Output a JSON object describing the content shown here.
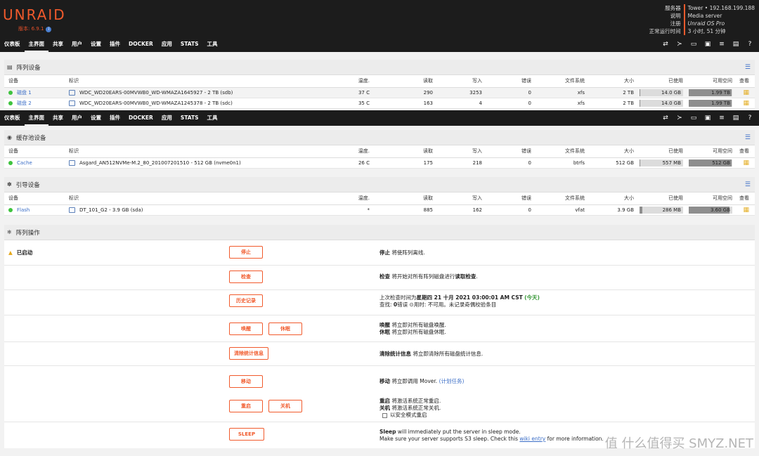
{
  "app": {
    "logo": "UNRAID",
    "version": "版本: 6.9.1"
  },
  "server": {
    "keys": [
      "服务器",
      "说明",
      "注册",
      "正常运行时间"
    ],
    "values": [
      "Tower • 192.168.199.188",
      "Media server",
      "Unraid OS Pro",
      "3 小时, 51 分钟"
    ]
  },
  "nav": {
    "items": [
      "仪表板",
      "主界面",
      "共享",
      "用户",
      "设置",
      "插件",
      "DOCKER",
      "应用",
      "STATS",
      "工具"
    ]
  },
  "array": {
    "title": "阵列设备",
    "headers": [
      "设备",
      "标识",
      "温度.",
      "读取",
      "写入",
      "错误",
      "文件系统",
      "大小",
      "已使用",
      "可用空间",
      "查看"
    ],
    "rows": [
      {
        "device": "磁盘 1",
        "id": "WDC_WD20EARS-00MVWB0_WD-WMAZA1645927 - 2 TB (sdb)",
        "temp": "37 C",
        "reads": "290",
        "writes": "3253",
        "errors": "0",
        "fs": "xfs",
        "size": "2 TB",
        "used": "14.0 GB",
        "used_frac": 0.01,
        "free": "1.99 TB",
        "free_frac": 0.99
      },
      {
        "device": "磁盘 2",
        "id": "WDC_WD20EARS-00MVWB0_WD-WMAZA1245378 - 2 TB (sdc)",
        "temp": "35 C",
        "reads": "163",
        "writes": "4",
        "errors": "0",
        "fs": "xfs",
        "size": "2 TB",
        "used": "14.0 GB",
        "used_frac": 0.01,
        "free": "1.99 TB",
        "free_frac": 0.99
      }
    ]
  },
  "cache": {
    "title": "缓存池设备",
    "headers": [
      "设备",
      "标识",
      "温度.",
      "读取",
      "写入",
      "错误",
      "文件系统",
      "大小",
      "已使用",
      "可用空间",
      "查看"
    ],
    "rows": [
      {
        "device": "Cache",
        "id": "Asgard_AN512NVMe-M.2_80_201007201510 - 512 GB (nvme0n1)",
        "temp": "26 C",
        "reads": "175",
        "writes": "218",
        "errors": "0",
        "fs": "btrfs",
        "size": "512 GB",
        "used": "557 MB",
        "used_frac": 0.01,
        "free": "512 GB",
        "free_frac": 0.99
      }
    ]
  },
  "boot": {
    "title": "引导设备",
    "headers": [
      "设备",
      "标识",
      "温度.",
      "读取",
      "写入",
      "错误",
      "文件系统",
      "大小",
      "已使用",
      "可用空间",
      "查看"
    ],
    "rows": [
      {
        "device": "Flash",
        "id": "DT_101_G2 - 3.9 GB (sda)",
        "temp": "*",
        "reads": "885",
        "writes": "162",
        "errors": "0",
        "fs": "vfat",
        "size": "3.9 GB",
        "used": "286 MB",
        "used_frac": 0.07,
        "free": "3.60 GB",
        "free_frac": 0.93
      }
    ]
  },
  "ops": {
    "title": "阵列操作",
    "status": "已启动",
    "stop_btn": "停止",
    "stop_key": "停止",
    "stop_desc": " 将使阵列离线.",
    "check_btn": "检查",
    "check_key": "检查",
    "check_desc": " 将开始对所有阵列磁盘进行",
    "check_bold": "读取检查",
    "check_end": ".",
    "history_btn": "历史记录",
    "last_check": "上次检查时间为",
    "last_check_date": "星期四 21 十月 2021 03:00:01 AM CST",
    "today": "(今天)",
    "found": "查找: ",
    "found_val": "0",
    "found_unit": "错误",
    "elapsed": "用时: 不可用。未记录奇偶校验条目",
    "wake_btn": "唤醒",
    "sleep_btn_cn": "休眠",
    "wake_key": "唤醒",
    "wake_desc": " 将立即对所有磁盘唤醒.",
    "sleep_key": "休眠",
    "sleep_desc": " 将立即对所有磁盘休眠.",
    "clear_btn": "清除统计信息",
    "clear_key": "清除统计信息",
    "clear_desc": " 将立即清除所有磁盘统计信息.",
    "move_btn": "移动",
    "move_key": "移动",
    "move_desc": " 将立即调用 Mover.",
    "move_link": "(计划任务)",
    "reboot_btn": "重启",
    "shutdown_btn": "关机",
    "reboot_key": "重启",
    "reboot_desc": " 将激活系统正常重启.",
    "shutdown_key": "关机",
    "shutdown_desc": " 将激活系统正常关机.",
    "safe_mode": "以安全模式重启",
    "s3_btn": "SLEEP",
    "s3_key": "Sleep",
    "s3_desc": " will immediately put the server in sleep mode.",
    "s3_desc2": "Make sure your server supports S3 sleep. Check this ",
    "s3_link": "wiki entry",
    "s3_desc3": " for more information."
  },
  "watermark": "值 什么值得买 SMYZ.NET",
  "colors": {
    "accent": "#f15a2c",
    "ok": "#3ec33e",
    "link": "#3b6ec7",
    "topbar": "#1c1c1c"
  }
}
